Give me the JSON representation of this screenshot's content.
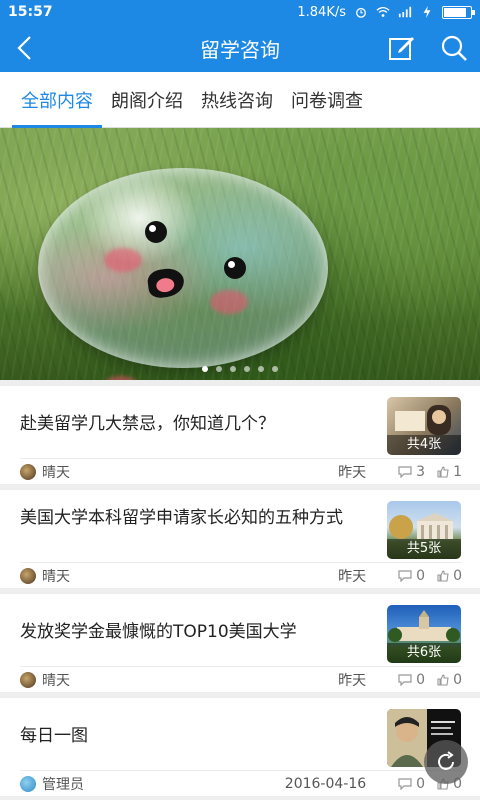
{
  "status_bar": {
    "time": "15:57",
    "speed": "1.84K/s"
  },
  "header": {
    "title": "留学咨询",
    "back_icon": "back-arrow-icon",
    "compose_icon": "edit-icon",
    "search_icon": "search-icon"
  },
  "tabs": [
    {
      "label": "全部内容",
      "active": true
    },
    {
      "label": "朗阁介绍",
      "active": false
    },
    {
      "label": "热线咨询",
      "active": false
    },
    {
      "label": "问卷调查",
      "active": false
    }
  ],
  "banner": {
    "slide_count": 6,
    "active_index": 0
  },
  "articles": [
    {
      "title": "赴美留学几大禁忌，你知道几个？",
      "thumb_label": "共4张",
      "author": "晴天",
      "date": "昨天",
      "comments": "3",
      "likes": "1"
    },
    {
      "title": "美国大学本科留学申请家长必知的五种方式",
      "thumb_label": "共5张",
      "author": "晴天",
      "date": "昨天",
      "comments": "0",
      "likes": "0"
    },
    {
      "title": "发放奖学金最慷慨的TOP10美国大学",
      "thumb_label": "共6张",
      "author": "晴天",
      "date": "昨天",
      "comments": "0",
      "likes": "0"
    },
    {
      "title": "每日一图",
      "thumb_label": "",
      "author": "管理员",
      "date": "2016-04-16",
      "comments": "0",
      "likes": "0"
    }
  ],
  "colors": {
    "primary": "#1E88E5",
    "background": "#eeeeee"
  }
}
